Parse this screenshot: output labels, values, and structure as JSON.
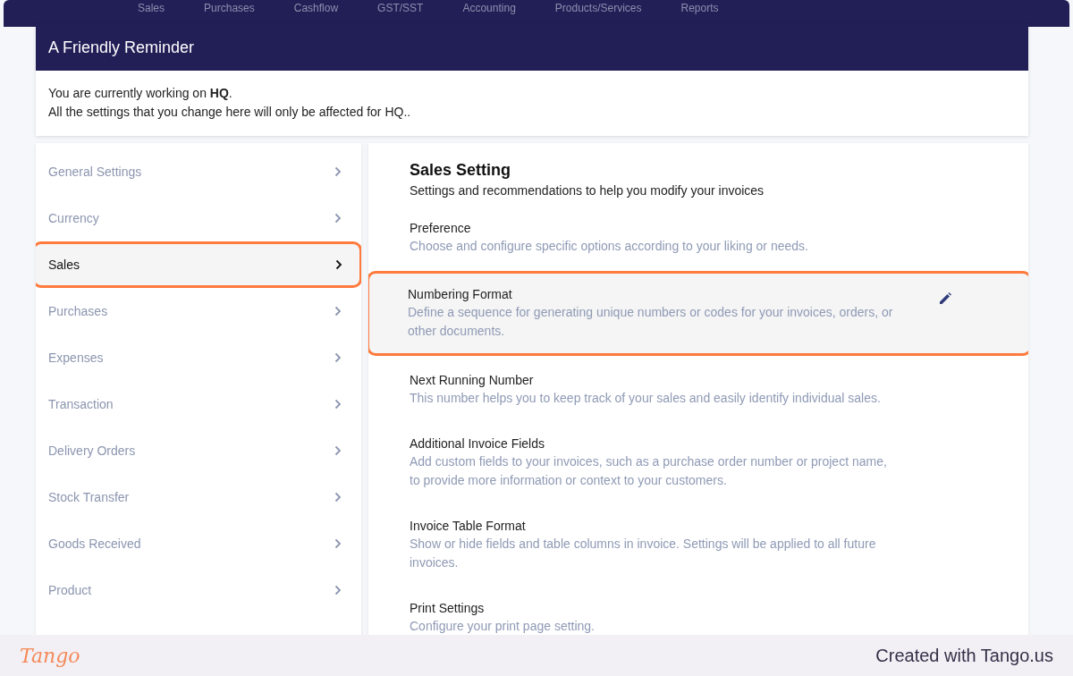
{
  "top_nav": {
    "items": [
      {
        "label": "Sales"
      },
      {
        "label": "Purchases"
      },
      {
        "label": "Cashflow"
      },
      {
        "label": "GST/SST"
      },
      {
        "label": "Accounting"
      },
      {
        "label": "Products/Services"
      },
      {
        "label": "Reports"
      }
    ]
  },
  "reminder": {
    "title": "A Friendly Reminder",
    "lines": [
      "You are currently working on **HQ**.",
      "All the settings that you change here will only be affected for HQ.."
    ]
  },
  "sidebar": {
    "items": [
      {
        "label": "General Settings",
        "selected": false
      },
      {
        "label": "Currency",
        "selected": false
      },
      {
        "label": "Sales",
        "selected": true
      },
      {
        "label": "Purchases",
        "selected": false
      },
      {
        "label": "Expenses",
        "selected": false
      },
      {
        "label": "Transaction",
        "selected": false
      },
      {
        "label": "Delivery Orders",
        "selected": false
      },
      {
        "label": "Stock Transfer",
        "selected": false
      },
      {
        "label": "Goods Received",
        "selected": false
      },
      {
        "label": "Product",
        "selected": false
      }
    ]
  },
  "main": {
    "title": "Sales Setting",
    "subtitle": "Settings and recommendations to help you modify your invoices",
    "settings": [
      {
        "title": "Preference",
        "description": "Choose and configure specific options according to your liking or needs.",
        "highlighted": false
      },
      {
        "title": "Numbering Format",
        "description": "Define a sequence for generating unique numbers or codes for your invoices, orders, or other documents.",
        "highlighted": true
      },
      {
        "title": "Next Running Number",
        "description": "This number helps you to keep track of your sales and easily identify individual sales.",
        "highlighted": false
      },
      {
        "title": "Additional Invoice Fields",
        "description": "Add custom fields to your invoices, such as a purchase order number or project name, to provide more information or context to your customers.",
        "highlighted": false
      },
      {
        "title": "Invoice Table Format",
        "description": "Show or hide fields and table columns in invoice. Settings will be applied to all future invoices.",
        "highlighted": false
      },
      {
        "title": "Print Settings",
        "description": "Configure your print page setting.",
        "highlighted": false
      }
    ]
  },
  "footer": {
    "logo": "Tango",
    "credit": "Created with Tango.us"
  }
}
